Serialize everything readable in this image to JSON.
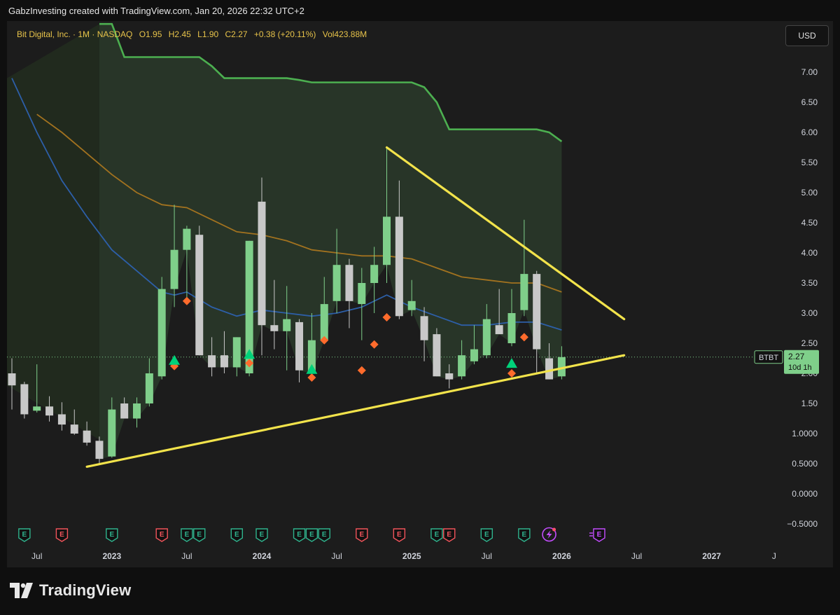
{
  "header": {
    "credit": "GabzInvesting created with TradingView.com, Jan 20, 2026 22:32 UTC+2"
  },
  "legend": {
    "symbol": "Bit Digital, Inc. · 1M · NASDAQ",
    "open": "O1.95",
    "high": "H2.45",
    "low": "L1.90",
    "close": "C2.27",
    "change": "+0.38 (+20.11%)",
    "volume": "Vol423.88M"
  },
  "currency_button": "USD",
  "price_label": {
    "ticker": "BTBT",
    "price": "2.27",
    "countdown": "10d 1h"
  },
  "footer": {
    "brand": "TradingView"
  },
  "colors": {
    "up": "#7fcf8a",
    "down": "#c8c8c8",
    "trendline": "#f2e34b",
    "upper_band": "#4caf50",
    "ma_fast": "#2d5fa8",
    "ma_slow": "#a2721f",
    "buy_marker": "#00d27a",
    "sell_marker": "#ff6b2c",
    "earnings_green": "#2fb38d",
    "earnings_red": "#f2545b",
    "earnings_purple": "#c44dff"
  },
  "chart_data": {
    "type": "candlestick",
    "interval": "1M",
    "ylim": [
      -0.5,
      7.4
    ],
    "yticks": [
      "7.00",
      "6.50",
      "6.00",
      "5.50",
      "5.00",
      "4.50",
      "4.00",
      "3.50",
      "3.00",
      "2.50",
      "2.00",
      "1.50",
      "1.0000",
      "0.5000",
      "0.0000",
      "−0.5000"
    ],
    "x_labels": [
      "Jul",
      "2023",
      "Jul",
      "2024",
      "Jul",
      "2025",
      "Jul",
      "2026",
      "Jul",
      "2027",
      "J"
    ],
    "candles": [
      {
        "date": "2022-05",
        "o": 2.0,
        "h": 2.25,
        "l": 1.4,
        "c": 1.8
      },
      {
        "date": "2022-06",
        "o": 1.82,
        "h": 1.86,
        "l": 1.25,
        "c": 1.32
      },
      {
        "date": "2022-07",
        "o": 1.38,
        "h": 2.15,
        "l": 1.35,
        "c": 1.45
      },
      {
        "date": "2022-08",
        "o": 1.45,
        "h": 1.62,
        "l": 1.2,
        "c": 1.3
      },
      {
        "date": "2022-09",
        "o": 1.32,
        "h": 1.52,
        "l": 1.05,
        "c": 1.15
      },
      {
        "date": "2022-10",
        "o": 1.15,
        "h": 1.4,
        "l": 0.98,
        "c": 1.0
      },
      {
        "date": "2022-11",
        "o": 1.05,
        "h": 1.2,
        "l": 0.8,
        "c": 0.85
      },
      {
        "date": "2022-12",
        "o": 0.88,
        "h": 0.95,
        "l": 0.5,
        "c": 0.58
      },
      {
        "date": "2023-01",
        "o": 0.62,
        "h": 1.6,
        "l": 0.6,
        "c": 1.4
      },
      {
        "date": "2023-02",
        "o": 1.5,
        "h": 1.6,
        "l": 1.25,
        "c": 1.25
      },
      {
        "date": "2023-03",
        "o": 1.25,
        "h": 1.6,
        "l": 1.1,
        "c": 1.5
      },
      {
        "date": "2023-04",
        "o": 1.5,
        "h": 2.25,
        "l": 1.45,
        "c": 2.0
      },
      {
        "date": "2023-05",
        "o": 1.95,
        "h": 3.6,
        "l": 1.9,
        "c": 3.4
      },
      {
        "date": "2023-06",
        "o": 3.4,
        "h": 4.8,
        "l": 3.1,
        "c": 4.05
      },
      {
        "date": "2023-07",
        "o": 4.05,
        "h": 4.45,
        "l": 3.2,
        "c": 4.4
      },
      {
        "date": "2023-08",
        "o": 4.3,
        "h": 4.45,
        "l": 2.3,
        "c": 2.3
      },
      {
        "date": "2023-09",
        "o": 2.3,
        "h": 2.6,
        "l": 1.95,
        "c": 2.1
      },
      {
        "date": "2023-10",
        "o": 2.3,
        "h": 2.7,
        "l": 2.0,
        "c": 2.1
      },
      {
        "date": "2023-11",
        "o": 2.1,
        "h": 2.6,
        "l": 1.95,
        "c": 2.6
      },
      {
        "date": "2023-12",
        "o": 2.0,
        "h": 4.2,
        "l": 1.95,
        "c": 4.2
      },
      {
        "date": "2024-01",
        "o": 4.85,
        "h": 5.25,
        "l": 2.3,
        "c": 2.8
      },
      {
        "date": "2024-02",
        "o": 2.8,
        "h": 3.55,
        "l": 2.4,
        "c": 2.7
      },
      {
        "date": "2024-03",
        "o": 2.7,
        "h": 3.45,
        "l": 2.05,
        "c": 2.9
      },
      {
        "date": "2024-04",
        "o": 2.85,
        "h": 2.9,
        "l": 1.85,
        "c": 2.05
      },
      {
        "date": "2024-05",
        "o": 2.0,
        "h": 3.0,
        "l": 1.9,
        "c": 2.55
      },
      {
        "date": "2024-06",
        "o": 2.55,
        "h": 3.6,
        "l": 2.5,
        "c": 3.15
      },
      {
        "date": "2024-07",
        "o": 3.2,
        "h": 4.4,
        "l": 3.0,
        "c": 3.8
      },
      {
        "date": "2024-08",
        "o": 3.8,
        "h": 3.9,
        "l": 2.75,
        "c": 3.2
      },
      {
        "date": "2024-09",
        "o": 3.15,
        "h": 3.75,
        "l": 2.55,
        "c": 3.5
      },
      {
        "date": "2024-10",
        "o": 3.5,
        "h": 4.1,
        "l": 3.0,
        "c": 3.8
      },
      {
        "date": "2024-11",
        "o": 3.8,
        "h": 5.75,
        "l": 3.5,
        "c": 4.6
      },
      {
        "date": "2024-12",
        "o": 4.6,
        "h": 5.2,
        "l": 2.9,
        "c": 2.95
      },
      {
        "date": "2025-01",
        "o": 3.05,
        "h": 3.55,
        "l": 2.95,
        "c": 3.2
      },
      {
        "date": "2025-02",
        "o": 2.95,
        "h": 3.1,
        "l": 2.2,
        "c": 2.55
      },
      {
        "date": "2025-03",
        "o": 2.65,
        "h": 2.75,
        "l": 1.95,
        "c": 1.95
      },
      {
        "date": "2025-04",
        "o": 2.0,
        "h": 2.15,
        "l": 1.75,
        "c": 1.9
      },
      {
        "date": "2025-05",
        "o": 1.95,
        "h": 2.55,
        "l": 1.9,
        "c": 2.3
      },
      {
        "date": "2025-06",
        "o": 2.2,
        "h": 2.8,
        "l": 2.15,
        "c": 2.4
      },
      {
        "date": "2025-07",
        "o": 2.3,
        "h": 3.15,
        "l": 2.25,
        "c": 2.9
      },
      {
        "date": "2025-08",
        "o": 2.8,
        "h": 3.4,
        "l": 2.7,
        "c": 2.65
      },
      {
        "date": "2025-09",
        "o": 2.5,
        "h": 3.4,
        "l": 2.45,
        "c": 3.0
      },
      {
        "date": "2025-10",
        "o": 3.05,
        "h": 4.55,
        "l": 2.95,
        "c": 3.65
      },
      {
        "date": "2025-11",
        "o": 3.65,
        "h": 3.7,
        "l": 2.0,
        "c": 2.4
      },
      {
        "date": "2025-12",
        "o": 2.25,
        "h": 2.5,
        "l": 1.9,
        "c": 1.9
      },
      {
        "date": "2026-01",
        "o": 1.95,
        "h": 2.45,
        "l": 1.9,
        "c": 2.27
      }
    ],
    "upper_band": [
      {
        "date": "2022-12",
        "v": 7.8
      },
      {
        "date": "2023-01",
        "v": 7.8
      },
      {
        "date": "2023-02",
        "v": 7.25
      },
      {
        "date": "2023-03",
        "v": 7.25
      },
      {
        "date": "2023-04",
        "v": 7.25
      },
      {
        "date": "2023-05",
        "v": 7.25
      },
      {
        "date": "2023-06",
        "v": 7.25
      },
      {
        "date": "2023-07",
        "v": 7.25
      },
      {
        "date": "2023-08",
        "v": 7.25
      },
      {
        "date": "2023-09",
        "v": 7.1
      },
      {
        "date": "2023-10",
        "v": 6.9
      },
      {
        "date": "2023-11",
        "v": 6.9
      },
      {
        "date": "2023-12",
        "v": 6.9
      },
      {
        "date": "2024-01",
        "v": 6.9
      },
      {
        "date": "2024-02",
        "v": 6.9
      },
      {
        "date": "2024-03",
        "v": 6.9
      },
      {
        "date": "2024-04",
        "v": 6.87
      },
      {
        "date": "2024-05",
        "v": 6.83
      },
      {
        "date": "2024-06",
        "v": 6.83
      },
      {
        "date": "2024-07",
        "v": 6.83
      },
      {
        "date": "2024-08",
        "v": 6.83
      },
      {
        "date": "2024-09",
        "v": 6.83
      },
      {
        "date": "2024-10",
        "v": 6.83
      },
      {
        "date": "2024-11",
        "v": 6.83
      },
      {
        "date": "2024-12",
        "v": 6.83
      },
      {
        "date": "2025-01",
        "v": 6.83
      },
      {
        "date": "2025-02",
        "v": 6.75
      },
      {
        "date": "2025-03",
        "v": 6.5
      },
      {
        "date": "2025-04",
        "v": 6.05
      },
      {
        "date": "2025-05",
        "v": 6.05
      },
      {
        "date": "2025-06",
        "v": 6.05
      },
      {
        "date": "2025-07",
        "v": 6.05
      },
      {
        "date": "2025-08",
        "v": 6.05
      },
      {
        "date": "2025-09",
        "v": 6.05
      },
      {
        "date": "2025-10",
        "v": 6.05
      },
      {
        "date": "2025-11",
        "v": 6.05
      },
      {
        "date": "2025-12",
        "v": 6.0
      },
      {
        "date": "2026-01",
        "v": 5.85
      }
    ],
    "ma_fast": [
      {
        "date": "2022-05",
        "v": 6.9
      },
      {
        "date": "2022-07",
        "v": 6.0
      },
      {
        "date": "2022-09",
        "v": 5.2
      },
      {
        "date": "2022-11",
        "v": 4.6
      },
      {
        "date": "2023-01",
        "v": 4.05
      },
      {
        "date": "2023-03",
        "v": 3.7
      },
      {
        "date": "2023-05",
        "v": 3.35
      },
      {
        "date": "2023-06",
        "v": 3.3
      },
      {
        "date": "2023-07",
        "v": 3.35
      },
      {
        "date": "2023-09",
        "v": 3.1
      },
      {
        "date": "2023-11",
        "v": 2.95
      },
      {
        "date": "2024-01",
        "v": 3.05
      },
      {
        "date": "2024-03",
        "v": 3.0
      },
      {
        "date": "2024-05",
        "v": 2.95
      },
      {
        "date": "2024-07",
        "v": 3.0
      },
      {
        "date": "2024-09",
        "v": 3.1
      },
      {
        "date": "2024-11",
        "v": 3.3
      },
      {
        "date": "2025-01",
        "v": 3.1
      },
      {
        "date": "2025-03",
        "v": 2.95
      },
      {
        "date": "2025-05",
        "v": 2.8
      },
      {
        "date": "2025-07",
        "v": 2.8
      },
      {
        "date": "2025-09",
        "v": 2.85
      },
      {
        "date": "2025-11",
        "v": 2.85
      },
      {
        "date": "2026-01",
        "v": 2.72
      }
    ],
    "ma_slow": [
      {
        "date": "2022-07",
        "v": 6.3
      },
      {
        "date": "2022-09",
        "v": 6.0
      },
      {
        "date": "2022-11",
        "v": 5.65
      },
      {
        "date": "2023-01",
        "v": 5.3
      },
      {
        "date": "2023-03",
        "v": 5.0
      },
      {
        "date": "2023-05",
        "v": 4.8
      },
      {
        "date": "2023-07",
        "v": 4.75
      },
      {
        "date": "2023-09",
        "v": 4.55
      },
      {
        "date": "2023-11",
        "v": 4.35
      },
      {
        "date": "2024-01",
        "v": 4.3
      },
      {
        "date": "2024-03",
        "v": 4.2
      },
      {
        "date": "2024-05",
        "v": 4.05
      },
      {
        "date": "2024-07",
        "v": 4.0
      },
      {
        "date": "2024-09",
        "v": 3.95
      },
      {
        "date": "2024-11",
        "v": 3.95
      },
      {
        "date": "2025-01",
        "v": 3.9
      },
      {
        "date": "2025-03",
        "v": 3.75
      },
      {
        "date": "2025-05",
        "v": 3.6
      },
      {
        "date": "2025-07",
        "v": 3.55
      },
      {
        "date": "2025-09",
        "v": 3.5
      },
      {
        "date": "2025-11",
        "v": 3.5
      },
      {
        "date": "2026-01",
        "v": 3.35
      }
    ],
    "trendlines": [
      {
        "name": "support",
        "from": {
          "date": "2022-11",
          "v": 0.45
        },
        "to": {
          "date": "2026-06",
          "v": 2.3
        }
      },
      {
        "name": "resistance",
        "from": {
          "date": "2024-11",
          "v": 5.75
        },
        "to": {
          "date": "2026-06",
          "v": 2.9
        }
      }
    ],
    "buy_markers": [
      {
        "date": "2023-06",
        "v": 2.2
      },
      {
        "date": "2023-12",
        "v": 2.3
      },
      {
        "date": "2024-05",
        "v": 2.05
      },
      {
        "date": "2025-09",
        "v": 2.15
      }
    ],
    "sell_markers": [
      {
        "date": "2023-06",
        "v": 2.12
      },
      {
        "date": "2023-07",
        "v": 3.2
      },
      {
        "date": "2023-12",
        "v": 2.17
      },
      {
        "date": "2024-05",
        "v": 1.93
      },
      {
        "date": "2024-06",
        "v": 2.55
      },
      {
        "date": "2024-09",
        "v": 2.05
      },
      {
        "date": "2024-10",
        "v": 2.48
      },
      {
        "date": "2024-11",
        "v": 2.93
      },
      {
        "date": "2025-09",
        "v": 2.0
      },
      {
        "date": "2025-10",
        "v": 2.6
      }
    ],
    "events": [
      {
        "date": "2022-06",
        "kind": "earnings",
        "color": "green",
        "label": "E"
      },
      {
        "date": "2022-09",
        "kind": "earnings",
        "color": "red",
        "label": "E"
      },
      {
        "date": "2023-01",
        "kind": "earnings",
        "color": "green",
        "label": "E"
      },
      {
        "date": "2023-05",
        "kind": "earnings",
        "color": "red",
        "label": "E"
      },
      {
        "date": "2023-07",
        "kind": "earnings",
        "color": "green",
        "label": "E"
      },
      {
        "date": "2023-08",
        "kind": "earnings",
        "color": "green",
        "label": "E"
      },
      {
        "date": "2023-11",
        "kind": "earnings",
        "color": "green",
        "label": "E"
      },
      {
        "date": "2024-01",
        "kind": "earnings",
        "color": "green",
        "label": "E"
      },
      {
        "date": "2024-04",
        "kind": "earnings",
        "color": "green",
        "label": "E"
      },
      {
        "date": "2024-05",
        "kind": "earnings",
        "color": "green",
        "label": "E"
      },
      {
        "date": "2024-06",
        "kind": "earnings",
        "color": "green",
        "label": "E"
      },
      {
        "date": "2024-09",
        "kind": "earnings",
        "color": "red",
        "label": "E"
      },
      {
        "date": "2024-12",
        "kind": "earnings",
        "color": "red",
        "label": "E"
      },
      {
        "date": "2025-03",
        "kind": "earnings",
        "color": "green",
        "label": "E"
      },
      {
        "date": "2025-04",
        "kind": "earnings",
        "color": "red",
        "label": "E"
      },
      {
        "date": "2025-07",
        "kind": "earnings",
        "color": "green",
        "label": "E"
      },
      {
        "date": "2025-10",
        "kind": "earnings",
        "color": "green",
        "label": "E"
      },
      {
        "date": "2025-12",
        "kind": "lightning",
        "color": "purple",
        "label": ""
      },
      {
        "date": "2026-04",
        "kind": "earnings-upcoming",
        "color": "purple",
        "label": "E"
      }
    ]
  }
}
